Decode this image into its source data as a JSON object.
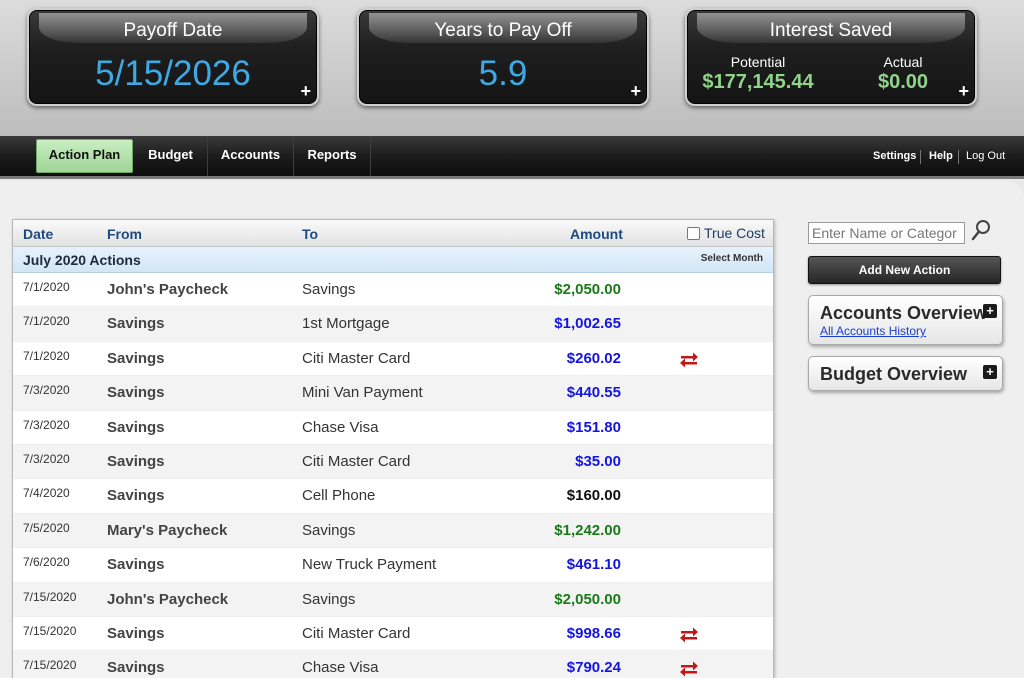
{
  "summary": {
    "payoff": {
      "title": "Payoff Date",
      "value": "5/15/2026",
      "expand": "+"
    },
    "years": {
      "title": "Years to Pay Off",
      "value": "5.9",
      "expand": "+"
    },
    "interest": {
      "title": "Interest Saved",
      "potential_label": "Potential",
      "potential_value": "$177,145.44",
      "actual_label": "Actual",
      "actual_value": "$0.00",
      "expand": "+"
    }
  },
  "nav": {
    "tabs": [
      "Action Plan",
      "Budget",
      "Accounts",
      "Reports"
    ],
    "active_tab": "Action Plan",
    "settings": "Settings",
    "help": "Help",
    "logout": "Log Out"
  },
  "table": {
    "headers": {
      "date": "Date",
      "from": "From",
      "to": "To",
      "amount": "Amount",
      "true_cost": "True Cost"
    },
    "month_title": "July 2020 Actions",
    "select_month": "Select Month",
    "rows": [
      {
        "date": "7/1/2020",
        "from": "John's Paycheck",
        "to": "Savings",
        "amount": "$2,050.00",
        "color": "#1a7a1a",
        "transfer": false
      },
      {
        "date": "7/1/2020",
        "from": "Savings",
        "to": "1st Mortgage",
        "amount": "$1,002.65",
        "color": "#1515e0",
        "transfer": false
      },
      {
        "date": "7/1/2020",
        "from": "Savings",
        "to": "Citi Master Card",
        "amount": "$260.02",
        "color": "#1515e0",
        "transfer": true
      },
      {
        "date": "7/3/2020",
        "from": "Savings",
        "to": "Mini Van Payment",
        "amount": "$440.55",
        "color": "#1515e0",
        "transfer": false
      },
      {
        "date": "7/3/2020",
        "from": "Savings",
        "to": "Chase Visa",
        "amount": "$151.80",
        "color": "#1515e0",
        "transfer": false
      },
      {
        "date": "7/3/2020",
        "from": "Savings",
        "to": "Citi Master Card",
        "amount": "$35.00",
        "color": "#1515e0",
        "transfer": false
      },
      {
        "date": "7/4/2020",
        "from": "Savings",
        "to": "Cell Phone",
        "amount": "$160.00",
        "color": "#111111",
        "transfer": false
      },
      {
        "date": "7/5/2020",
        "from": "Mary's Paycheck",
        "to": "Savings",
        "amount": "$1,242.00",
        "color": "#1a7a1a",
        "transfer": false
      },
      {
        "date": "7/6/2020",
        "from": "Savings",
        "to": "New Truck Payment",
        "amount": "$461.10",
        "color": "#1515e0",
        "transfer": false
      },
      {
        "date": "7/15/2020",
        "from": "John's Paycheck",
        "to": "Savings",
        "amount": "$2,050.00",
        "color": "#1a7a1a",
        "transfer": false
      },
      {
        "date": "7/15/2020",
        "from": "Savings",
        "to": "Citi Master Card",
        "amount": "$998.66",
        "color": "#1515e0",
        "transfer": true
      },
      {
        "date": "7/15/2020",
        "from": "Savings",
        "to": "Chase Visa",
        "amount": "$790.24",
        "color": "#1515e0",
        "transfer": true
      }
    ]
  },
  "sidebar": {
    "search_placeholder": "Enter Name or Categor",
    "add_button": "Add New Action",
    "accounts_title": "Accounts Overview",
    "accounts_link": "All Accounts History",
    "budget_title": "Budget Overview",
    "expand": "+"
  },
  "icons": {
    "transfer": "transfer-arrows-icon",
    "search": "search-icon"
  }
}
